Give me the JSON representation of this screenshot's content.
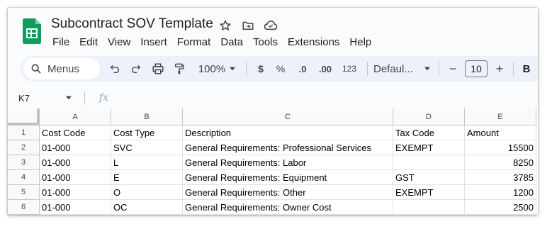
{
  "app": {
    "title": "Subcontract SOV Template"
  },
  "menu": [
    "File",
    "Edit",
    "View",
    "Insert",
    "Format",
    "Data",
    "Tools",
    "Extensions",
    "Help"
  ],
  "toolbar": {
    "search_placeholder": "Menus",
    "zoom": "100%",
    "currency": "$",
    "percent": "%",
    "decrease_decimal": ".0",
    "increase_decimal": ".00",
    "format_123": "123",
    "font": "Defaul...",
    "font_size": "10",
    "minus": "−",
    "plus": "+",
    "bold": "B"
  },
  "formula_bar": {
    "cell_ref": "K7",
    "fx": "fx"
  },
  "columns": [
    "A",
    "B",
    "C",
    "D",
    "E"
  ],
  "rows": [
    {
      "num": "1",
      "cells": [
        "Cost Code",
        "Cost Type",
        "Description",
        "Tax Code",
        "Amount"
      ]
    },
    {
      "num": "2",
      "cells": [
        "01-000",
        "SVC",
        "General Requirements: Professional Services",
        "EXEMPT",
        "15500"
      ]
    },
    {
      "num": "3",
      "cells": [
        "01-000",
        "L",
        "General Requirements: Labor",
        "",
        "8250"
      ]
    },
    {
      "num": "4",
      "cells": [
        "01-000",
        "E",
        "General Requirements: Equipment",
        "GST",
        "3785"
      ]
    },
    {
      "num": "5",
      "cells": [
        "01-000",
        "O",
        "General Requirements: Other",
        "EXEMPT",
        "1200"
      ]
    },
    {
      "num": "6",
      "cells": [
        "01-000",
        "OC",
        "General Requirements: Owner Cost",
        "",
        "2500"
      ]
    }
  ],
  "colors": {
    "sheets_green": "#0f9d58",
    "toolbar_bg": "#edf2fa",
    "header_bg": "#f8f9fa"
  }
}
